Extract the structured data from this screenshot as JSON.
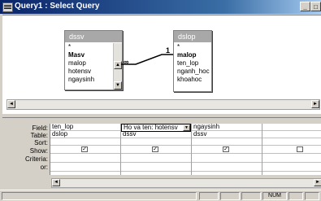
{
  "window": {
    "title": "Query1 : Select Query",
    "buttons": {
      "minimize": "_",
      "restore": "□"
    }
  },
  "tables": [
    {
      "name": "dssv",
      "fields": [
        "*",
        "Masv",
        "malop",
        "hotensv",
        "ngaysinh"
      ],
      "key_field": "Masv"
    },
    {
      "name": "dslop",
      "fields": [
        "*",
        "malop",
        "ten_lop",
        "nganh_hoc",
        "khoahoc"
      ],
      "key_field": "malop"
    }
  ],
  "relationship": {
    "one_side": "1",
    "many_side": "∞"
  },
  "grid": {
    "row_labels": [
      "Field:",
      "Table:",
      "Sort:",
      "Show:",
      "Criteria:",
      "or:"
    ],
    "columns": [
      {
        "field": "ten_lop",
        "table": "dslop",
        "sort": "",
        "show": true
      },
      {
        "field": "Ho va ten: hotensv",
        "table": "dssv",
        "sort": "",
        "show": true
      },
      {
        "field": "ngaysinh",
        "table": "dssv",
        "sort": "",
        "show": true
      },
      {
        "field": "",
        "table": "",
        "sort": "",
        "show": false
      }
    ]
  },
  "status": {
    "num": "NUM"
  },
  "icons": [
    "query-icon",
    "scroll-left-icon",
    "scroll-right-icon",
    "scroll-up-icon",
    "scroll-down-icon",
    "dropdown-arrow-icon"
  ]
}
